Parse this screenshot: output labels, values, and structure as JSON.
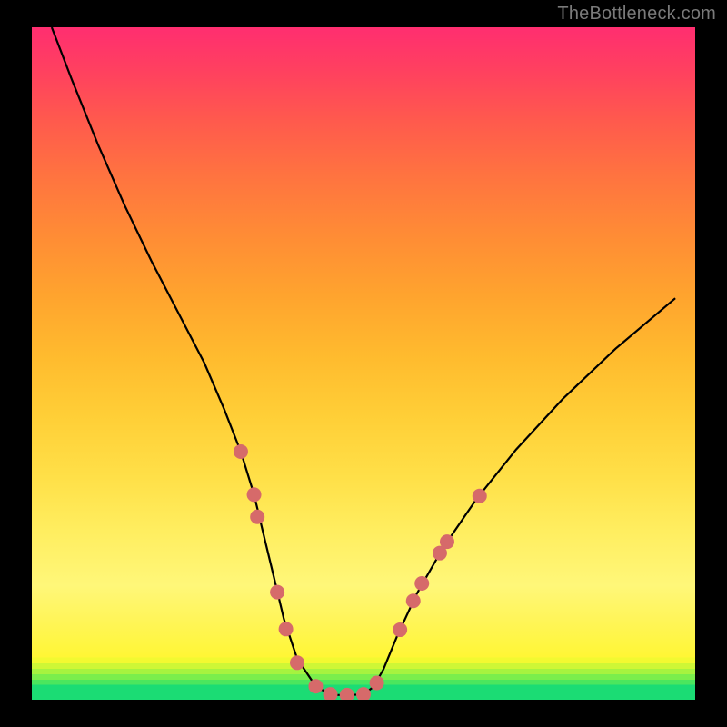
{
  "watermark": "TheBottleneck.com",
  "chart_data": {
    "type": "line",
    "title": "",
    "xlabel": "",
    "ylabel": "",
    "xlim": [
      0,
      100
    ],
    "ylim": [
      0,
      100
    ],
    "series": [
      {
        "name": "bottleneck-curve",
        "x": [
          3,
          6,
          10,
          14,
          18,
          22,
          26,
          29,
          31.5,
          33.5,
          35,
          36.5,
          38,
          40,
          43,
          46,
          48,
          50,
          51.5,
          53,
          55,
          58,
          62,
          67,
          73,
          80,
          88,
          97
        ],
        "y": [
          100,
          92.3,
          82.5,
          73.5,
          65.3,
          57.7,
          50.1,
          43.2,
          36.9,
          30.5,
          24.3,
          18.2,
          12,
          6.1,
          1.7,
          0.7,
          0.7,
          0.8,
          1.9,
          4.5,
          9.3,
          15.7,
          22.6,
          29.8,
          37.2,
          44.7,
          52.2,
          59.7
        ]
      }
    ],
    "markers": {
      "name": "guide-points",
      "color": "#d66a6a",
      "radius_px": 8,
      "points": [
        {
          "x": 31.5,
          "y": 36.9
        },
        {
          "x": 33.5,
          "y": 30.5
        },
        {
          "x": 34.0,
          "y": 27.2
        },
        {
          "x": 37.0,
          "y": 16.0
        },
        {
          "x": 38.3,
          "y": 10.5
        },
        {
          "x": 40.0,
          "y": 5.5
        },
        {
          "x": 42.8,
          "y": 2.0
        },
        {
          "x": 45.0,
          "y": 0.8
        },
        {
          "x": 47.5,
          "y": 0.7
        },
        {
          "x": 50.0,
          "y": 0.8
        },
        {
          "x": 52.0,
          "y": 2.5
        },
        {
          "x": 55.5,
          "y": 10.4
        },
        {
          "x": 57.5,
          "y": 14.7
        },
        {
          "x": 58.8,
          "y": 17.3
        },
        {
          "x": 61.5,
          "y": 21.8
        },
        {
          "x": 62.6,
          "y": 23.5
        },
        {
          "x": 67.5,
          "y": 30.3
        }
      ]
    },
    "background_gradient": {
      "top": "#ff2e70",
      "upper_mid": "#ff8c35",
      "mid": "#ffe048",
      "lower_mid": "#fff779",
      "bottom_bands": [
        "#f2f931",
        "#cef736",
        "#a6f33f",
        "#7aee4c",
        "#4be65e",
        "#1bdc74"
      ]
    }
  }
}
